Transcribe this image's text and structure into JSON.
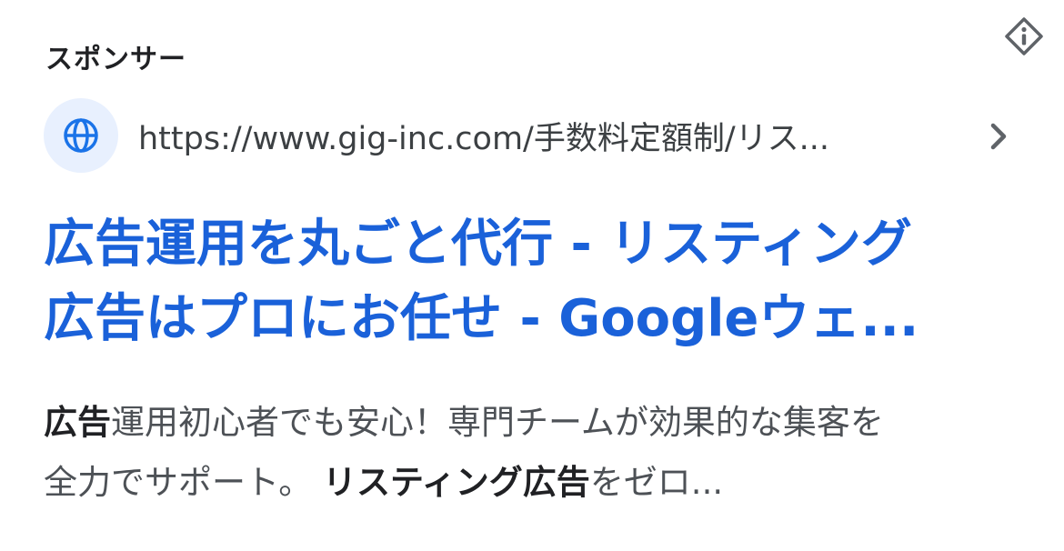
{
  "ad": {
    "sponsor_label": "スポンサー",
    "url": "https://www.gig-inc.com/手数料定額制/リス...",
    "headline_line1": "広告運用を丸ごと代行 - リスティング",
    "headline_line2": "広告はプロにお任せ - Googleウェ...",
    "description": {
      "line1_bold": "広告",
      "line1_rest": "運用初心者でも安心！専門チームが効果的な集客を",
      "line2_start": "全力でサポート。 ",
      "line2_bold": "リスティング広告",
      "line2_end": "をゼロ..."
    }
  },
  "icons": {
    "info": "info-diamond-icon",
    "favicon": "globe-icon",
    "chevron": "chevron-right-icon"
  },
  "colors": {
    "headline": "#1a61d9",
    "favicon_bg": "#e8f0fe",
    "favicon_fg": "#1a73e8",
    "text": "#202124",
    "muted": "#4d5156"
  }
}
